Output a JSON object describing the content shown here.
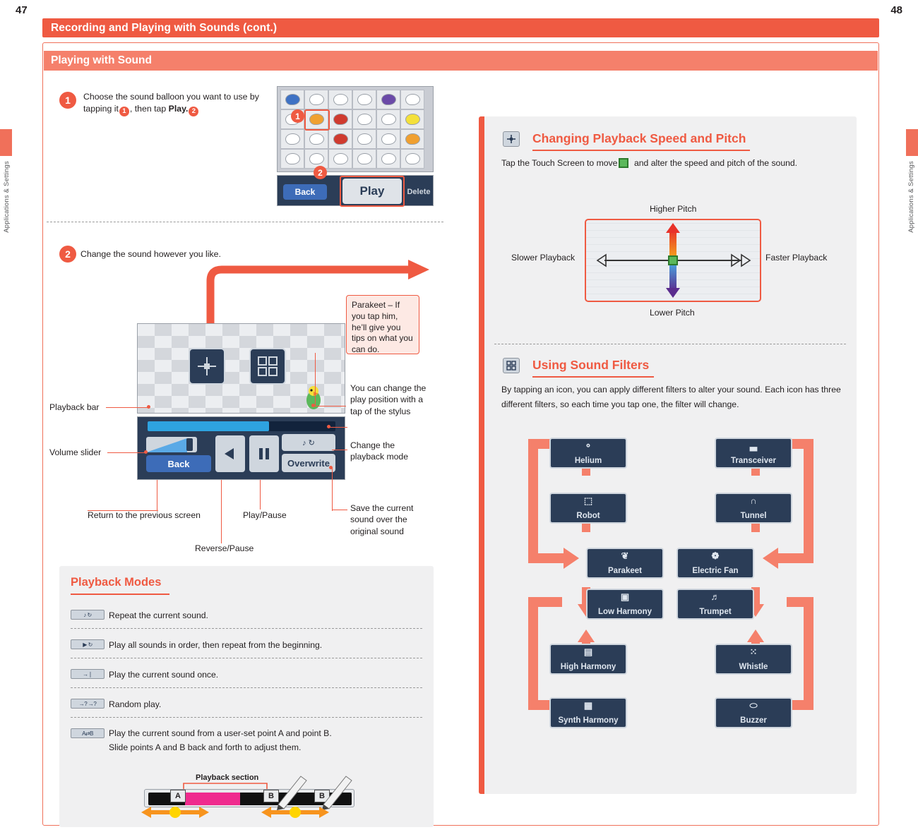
{
  "page": {
    "left_number": "47",
    "right_number": "48",
    "title": "Recording and Playing with Sounds (cont.)",
    "section": "Playing with Sound",
    "side_tab_left": "Applications & Settings",
    "side_tab_right": "Applications & Settings"
  },
  "left": {
    "step1": {
      "num": "1",
      "text_a": "Choose the sound balloon you want to use by",
      "text_b": "tapping it",
      "inline1": "1",
      "text_c": ", then tap",
      "bold": "Play.",
      "inline2": "2"
    },
    "ds1": {
      "back": "Back",
      "play": "Play",
      "delete": "Delete",
      "mark1": "1",
      "mark2": "2"
    },
    "step2": {
      "num": "2",
      "text": "Change the sound however you like."
    },
    "ds2": {
      "back": "Back",
      "overwrite": "Overwrite",
      "mode_icon": "♪ ↻"
    },
    "annotations": {
      "playback_bar": "Playback bar",
      "volume_slider": "Volume slider",
      "return_prev": "Return to the previous screen",
      "play_pause": "Play/Pause",
      "reverse_pause": "Reverse/Pause",
      "parakeet": "Parakeet – If you tap him, he’ll give you tips on what you can do.",
      "change_pos": "You can change the play position with a tap of the stylus",
      "change_mode": "Change the playback mode",
      "save_over": "Save the current sound over the original sound"
    },
    "playback_modes": {
      "title": "Playback Modes",
      "rows": [
        {
          "icon": "♪ ↻",
          "text": "Repeat the current sound."
        },
        {
          "icon": "▶ ↻",
          "text": "Play all sounds in order, then repeat from the beginning."
        },
        {
          "icon": "→❘",
          "text": "Play the current sound once."
        },
        {
          "icon": "→? →?",
          "text": "Random play."
        },
        {
          "icon": "A⇄B",
          "text_line1": "Play the current sound from a user-set point A and point B.",
          "text_line2": "Slide points A and B back and forth to adjust them."
        }
      ],
      "ab_bar": {
        "label": "Playback section",
        "a": "A",
        "b": "B"
      }
    }
  },
  "right": {
    "speed": {
      "heading": "Changing Playback Speed and Pitch",
      "intro_a": "Tap the Touch Screen to move",
      "intro_b": "and alter the speed and pitch of the sound.",
      "higher_pitch": "Higher Pitch",
      "lower_pitch": "Lower Pitch",
      "slower": "Slower Playback",
      "faster": "Faster Playback"
    },
    "filters": {
      "heading": "Using Sound Filters",
      "intro_line1": "By tapping an icon, you can apply different filters to alter your sound. Each icon has three",
      "intro_line2": "different filters, so each time you tap one, the filter will change.",
      "items": [
        {
          "name": "Helium",
          "glyph": "⚬"
        },
        {
          "name": "Transceiver",
          "glyph": "▃"
        },
        {
          "name": "Robot",
          "glyph": "⬚"
        },
        {
          "name": "Tunnel",
          "glyph": "∩"
        },
        {
          "name": "Parakeet",
          "glyph": "❦"
        },
        {
          "name": "Electric Fan",
          "glyph": "❁"
        },
        {
          "name": "Low Harmony",
          "glyph": "▣"
        },
        {
          "name": "Trumpet",
          "glyph": "♬"
        },
        {
          "name": "High Harmony",
          "glyph": "▤"
        },
        {
          "name": "Whistle",
          "glyph": "⁙"
        },
        {
          "name": "Synth Harmony",
          "glyph": "▦"
        },
        {
          "name": "Buzzer",
          "glyph": "⬭"
        }
      ]
    }
  },
  "colors": {
    "accent": "#ef5a42",
    "accent_light": "#f5806b",
    "panel": "#f0f0f1",
    "ds_dark": "#2b3d57"
  }
}
